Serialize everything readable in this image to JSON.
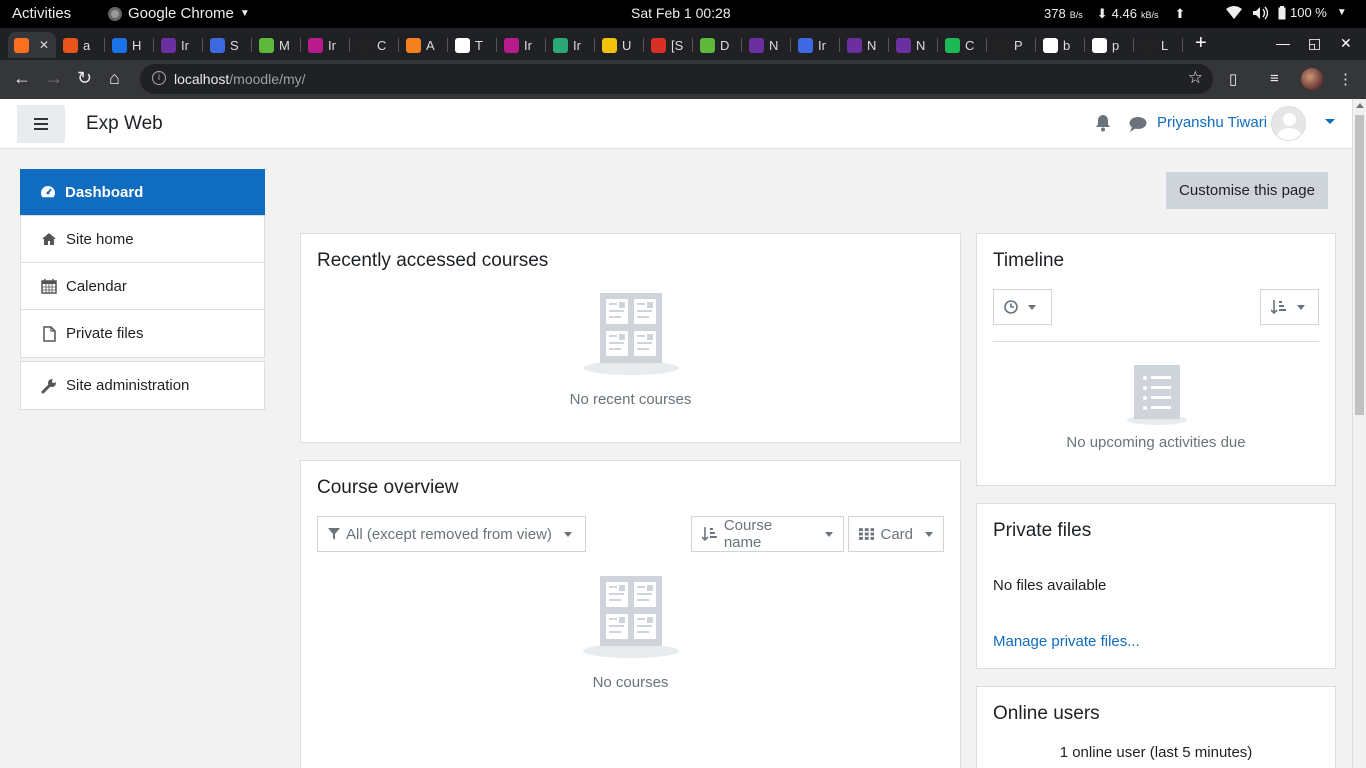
{
  "os_bar": {
    "activities": "Activities",
    "app_name": "Google Chrome",
    "clock": "Sat Feb 1  00:28",
    "net_up": "378",
    "net_up_unit": "B/s",
    "net_down": "4.46",
    "net_down_unit": "kB/s",
    "battery": "100 %"
  },
  "browser": {
    "tabs": [
      {
        "letter": "",
        "color": "#ff6f20"
      },
      {
        "letter": "a",
        "color": "#e8541a"
      },
      {
        "letter": "H",
        "color": "#1a73e8"
      },
      {
        "letter": "Ir",
        "color": "#6b2fa0"
      },
      {
        "letter": "S",
        "color": "#3d6ae0"
      },
      {
        "letter": "M",
        "color": "#5fb83c"
      },
      {
        "letter": "Ir",
        "color": "#b81c8c"
      },
      {
        "letter": "C",
        "color": "#222222"
      },
      {
        "letter": "A",
        "color": "#f4801f"
      },
      {
        "letter": "T",
        "color": "#ffffff"
      },
      {
        "letter": "Ir",
        "color": "#b81c8c"
      },
      {
        "letter": "Ir",
        "color": "#2aa876"
      },
      {
        "letter": "U",
        "color": "#f4c20d"
      },
      {
        "letter": "[S",
        "color": "#d93025"
      },
      {
        "letter": "D",
        "color": "#5fb83c"
      },
      {
        "letter": "N",
        "color": "#6b2fa0"
      },
      {
        "letter": "Ir",
        "color": "#3d6ae0"
      },
      {
        "letter": "N",
        "color": "#6b2fa0"
      },
      {
        "letter": "N",
        "color": "#6b2fa0"
      },
      {
        "letter": "C",
        "color": "#1db954"
      },
      {
        "letter": "P",
        "color": "#222222"
      },
      {
        "letter": "b",
        "color": "#ffffff"
      },
      {
        "letter": "p",
        "color": "#ffffff"
      },
      {
        "letter": "L",
        "color": "#222222"
      }
    ],
    "url_host": "localhost",
    "url_path": "/moodle/my/"
  },
  "navbar": {
    "site_name": "Exp Web",
    "user_name": "Priyanshu Tiwari"
  },
  "drawer": {
    "items": [
      {
        "label": "Dashboard"
      },
      {
        "label": "Site home"
      },
      {
        "label": "Calendar"
      },
      {
        "label": "Private files"
      }
    ],
    "admin_label": "Site administration"
  },
  "main": {
    "customise_label": "Customise this page",
    "recent": {
      "title": "Recently accessed courses",
      "empty": "No recent courses"
    },
    "overview": {
      "title": "Course overview",
      "filter": "All (except removed from view)",
      "sort": "Course name",
      "view": "Card",
      "empty": "No courses"
    },
    "timeline": {
      "title": "Timeline",
      "empty": "No upcoming activities due"
    },
    "private_files": {
      "title": "Private files",
      "empty": "No files available",
      "manage_link": "Manage private files..."
    },
    "online_users": {
      "title": "Online users",
      "summary": "1 online user (last 5 minutes)"
    }
  },
  "colors": {
    "brand": "#0f6cbf",
    "page_bg": "#f2f2f2"
  }
}
